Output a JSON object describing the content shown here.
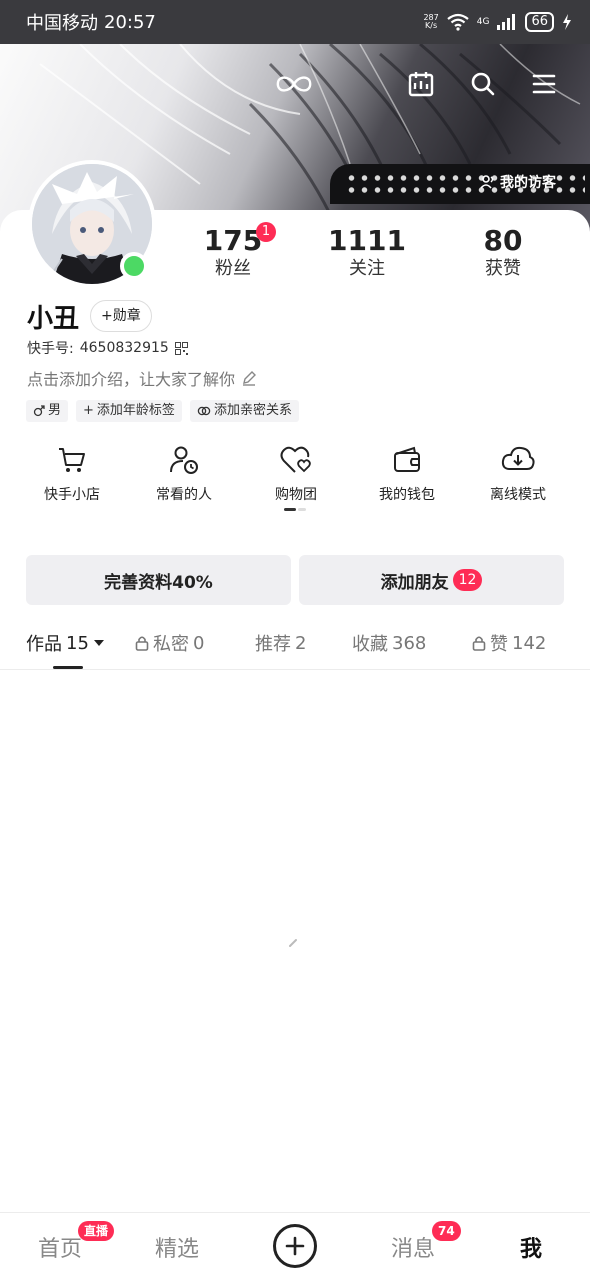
{
  "status_bar": {
    "carrier": "中国移动",
    "time": "20:57",
    "net_speed_value": "287",
    "net_speed_unit": "K/s",
    "signal_label": "4G",
    "battery": "66"
  },
  "header": {
    "visitors_label": "我的访客"
  },
  "profile": {
    "name": "小丑",
    "medal_label": "勋章",
    "kuaishou_id_label": "快手号:",
    "kuaishou_id": "4650832915",
    "intro_placeholder": "点击添加介绍，让大家了解你",
    "online": true
  },
  "stats": [
    {
      "value": "175",
      "label": "粉丝",
      "badge": "1"
    },
    {
      "value": "1111",
      "label": "关注"
    },
    {
      "value": "80",
      "label": "获赞"
    }
  ],
  "tags": [
    {
      "icon": "male-icon",
      "label": "男"
    },
    {
      "icon": "plus-icon",
      "label": "添加年龄标签"
    },
    {
      "icon": "link-rings-icon",
      "label": "添加亲密关系"
    }
  ],
  "shortcuts": [
    {
      "icon": "shopping-cart-icon",
      "label": "快手小店"
    },
    {
      "icon": "person-clock-icon",
      "label": "常看的人"
    },
    {
      "icon": "heart-group-icon",
      "label": "购物团"
    },
    {
      "icon": "wallet-icon",
      "label": "我的钱包"
    },
    {
      "icon": "cloud-download-icon",
      "label": "离线模式"
    }
  ],
  "actions": {
    "complete_profile": "完善资料40%",
    "add_friends": "添加朋友",
    "add_friends_badge": "12"
  },
  "tabs": [
    {
      "label": "作品",
      "count": "15",
      "active": true,
      "dropdown": true
    },
    {
      "label": "私密",
      "count": "0",
      "locked": true
    },
    {
      "label": "推荐",
      "count": "2"
    },
    {
      "label": "收藏",
      "count": "368"
    },
    {
      "label": "赞",
      "count": "142",
      "locked": true
    }
  ],
  "bottom_nav": {
    "home": "首页",
    "home_badge": "直播",
    "featured": "精选",
    "messages": "消息",
    "messages_badge": "74",
    "me": "我"
  },
  "colors": {
    "accent": "#fe2c55",
    "online": "#4cd964",
    "button_bg": "#efeff2"
  }
}
